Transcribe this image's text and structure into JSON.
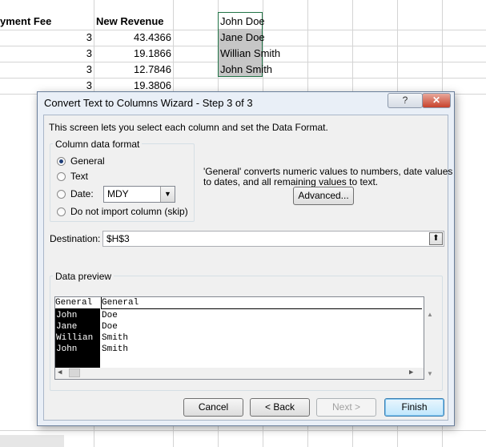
{
  "sheet": {
    "headers": [
      "yment Fee",
      "New Revenue"
    ],
    "rows": [
      {
        "fee": "3",
        "revenue": "43.4366"
      },
      {
        "fee": "3",
        "revenue": "19.1866"
      },
      {
        "fee": "3",
        "revenue": "12.7846"
      },
      {
        "fee": "3",
        "revenue": "19.3806"
      }
    ],
    "names": [
      "John Doe",
      "Jane Doe",
      "Willian Smith",
      "John Smith"
    ]
  },
  "dialog": {
    "title": "Convert Text to Columns Wizard - Step 3 of 3",
    "help_label": "?",
    "close_label": "✕",
    "intro": "This screen lets you select each column and set the Data Format.",
    "group_title": "Column data format",
    "options": {
      "general": "General",
      "text": "Text",
      "date": "Date:",
      "skip": "Do not import column (skip)"
    },
    "selected_option": "general",
    "date_format": "MDY",
    "description_line1": "'General' converts numeric values to numbers, date values",
    "description_line2": "to dates, and all remaining values to text.",
    "advanced_label": "Advanced...",
    "destination_label": "Destination:",
    "destination_value": "$H$3",
    "preview_title": "Data preview",
    "preview": {
      "headers": [
        "General",
        "General"
      ],
      "col1": [
        "John",
        "Jane",
        "Willian",
        "John"
      ],
      "col2": [
        "Doe",
        "Doe",
        "Smith",
        "Smith"
      ]
    },
    "buttons": {
      "cancel": "Cancel",
      "back": "< Back",
      "next": "Next >",
      "finish": "Finish"
    }
  }
}
